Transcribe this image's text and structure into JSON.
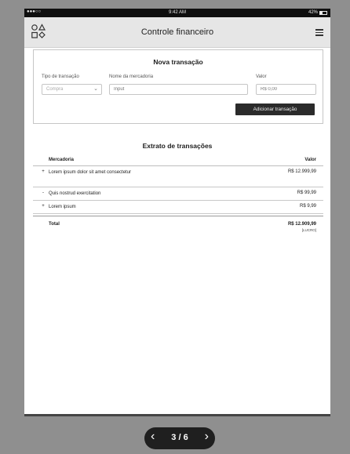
{
  "status_bar": {
    "signal": "●●●○○",
    "time": "9:42 AM",
    "battery": "42%",
    "battery_fraction": 0.42
  },
  "app": {
    "title": "Controle financeiro",
    "logo_icon": "shapes-icon",
    "menu_icon": "hamburger-icon"
  },
  "form": {
    "heading": "Nova transação",
    "type_label": "Tipo de transação",
    "type_value": "Compra",
    "name_label": "Nome da mercadoria",
    "name_placeholder": "Input",
    "value_label": "Valor",
    "value_placeholder": "R$ 0,00",
    "submit_label": "Adicionar transação"
  },
  "statement": {
    "heading": "Extrato de transações",
    "col_item": "Mercadoria",
    "col_value": "Valor",
    "rows": [
      {
        "sign": "+",
        "name": "Lorem ipsum dolor sit amet consectetur",
        "value": "R$ 12.999,99"
      },
      {
        "sign": "-",
        "name": "Quis nostrud exercitation",
        "value": "R$ 99,99"
      },
      {
        "sign": "+",
        "name": "Lorem ipsum",
        "value": "R$ 9,99"
      }
    ],
    "total_label": "Total",
    "total_value": "R$ 12.909,99",
    "total_note": "[LUCRO]"
  },
  "pager": {
    "text": "3 / 6",
    "prev_icon": "chevron-left-icon",
    "next_icon": "chevron-right-icon"
  }
}
